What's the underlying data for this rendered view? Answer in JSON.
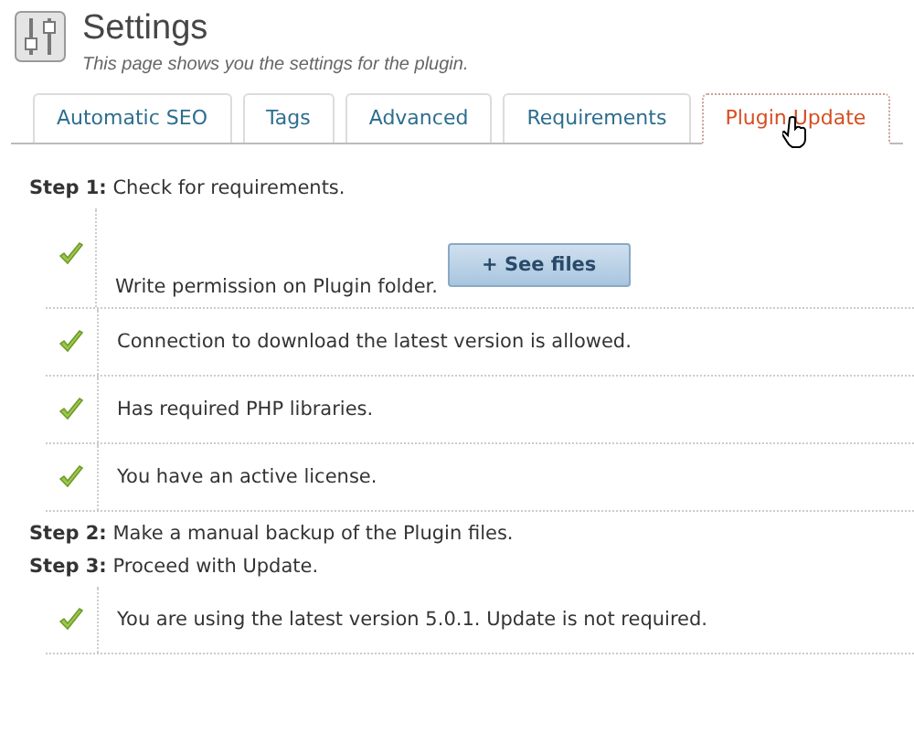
{
  "header": {
    "title": "Settings",
    "subtitle": "This page shows you the settings for the plugin."
  },
  "tabs": [
    {
      "label": "Automatic SEO",
      "selected": false
    },
    {
      "label": "Tags",
      "selected": false
    },
    {
      "label": "Advanced",
      "selected": false
    },
    {
      "label": "Requirements",
      "selected": false
    },
    {
      "label": "Plugin Update",
      "selected": true
    }
  ],
  "steps": [
    {
      "text": "**Step 1:** Check for requirements.",
      "checks": [
        {
          "text": "Write permission on Plugin folder.",
          "checked": true,
          "button": "+ See files"
        },
        {
          "text": "Connection to download the latest version is allowed.",
          "checked": true
        },
        {
          "text": "Has required PHP libraries.",
          "checked": true
        },
        {
          "text": "You have an active license.",
          "checked": true
        }
      ]
    },
    {
      "text": "**Step 2:** Make a manual backup of the Plugin files."
    },
    {
      "text": "**Step 3:** Proceed with Update.",
      "checks": [
        {
          "text": "You are using the latest version 5.0.1. Update is not required.",
          "checked": true
        }
      ]
    }
  ]
}
